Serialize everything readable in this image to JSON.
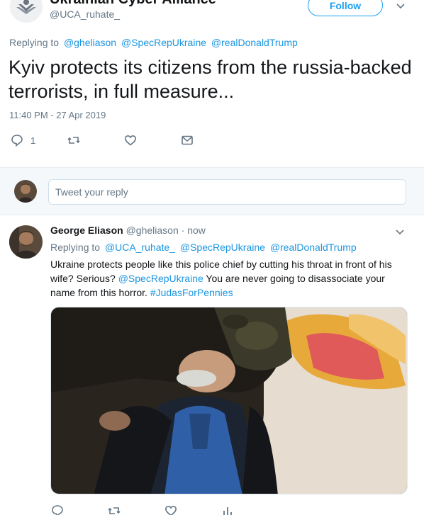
{
  "tweet": {
    "display_name": "Ukrainian Cyber Alliance",
    "handle": "@UCA_ruhate_",
    "follow_label": "Follow",
    "replying_prefix": "Replying to",
    "replying_to": [
      "@gheliason",
      "@SpecRepUkraine",
      "@realDonaldTrump"
    ],
    "text": "Kyiv protects its citizens from the russia-backed terrorists, in full measure...",
    "timestamp": "11:40 PM - 27 Apr 2019",
    "reply_count": "1"
  },
  "reply_box": {
    "placeholder": "Tweet your reply"
  },
  "reply_tweet": {
    "display_name": "George Eliason",
    "handle": "@gheliason",
    "time": "· now",
    "replying_prefix": "Replying to",
    "replying_to": [
      "@UCA_ruhate_",
      "@SpecRepUkraine",
      "@realDonaldTrump"
    ],
    "body_part1": "Ukraine protects people like this police chief by cutting his throat in front of his wife? Serious? ",
    "body_mention": "@SpecRepUkraine",
    "body_part2": " You are never going to disassociate your name from this horror. ",
    "body_hashtag": "#JudasForPennies"
  },
  "colors": {
    "link_blue": "#1b95e0",
    "secondary_gray": "#657786",
    "follow_blue": "#1da1f2"
  },
  "icons": [
    "reply-icon",
    "retweet-icon",
    "like-icon",
    "dm-icon",
    "chevron-down-icon",
    "analytics-icon"
  ]
}
